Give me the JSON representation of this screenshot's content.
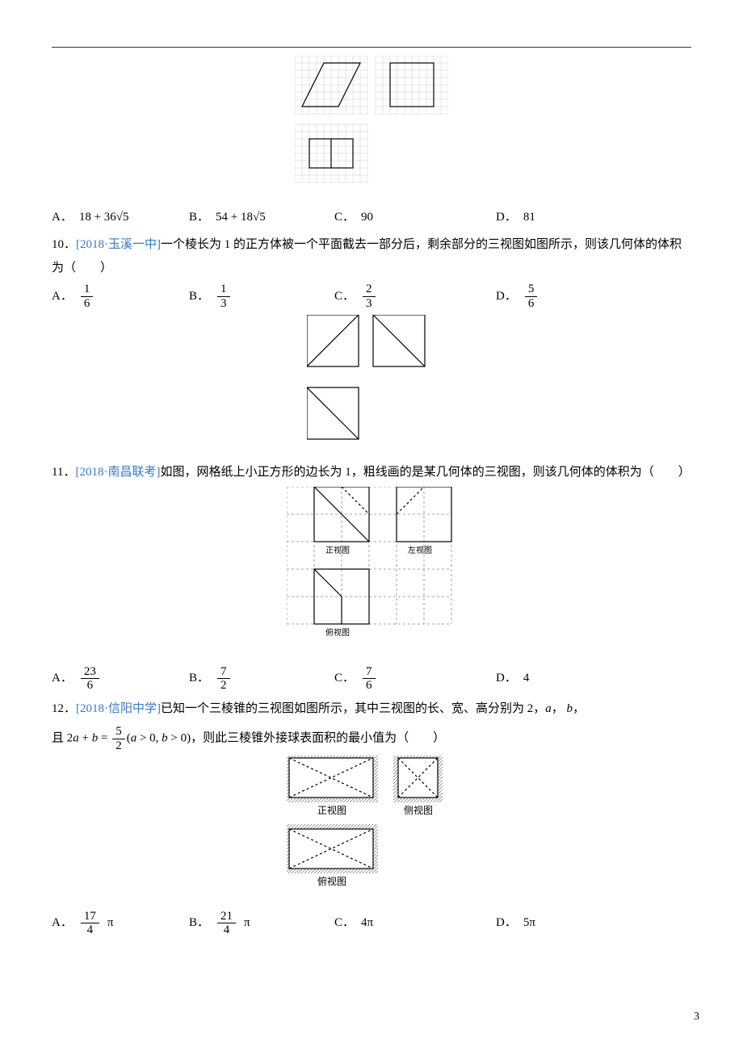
{
  "q9_options": {
    "A": "18 + 36√5",
    "B": "54 + 18√5",
    "C": "90",
    "D": "81"
  },
  "q10": {
    "source": "[2018·玉溪一中]",
    "stem": "一个棱长为 1 的正方体被一个平面截去一部分后，剩余部分的三视图如图所示，则该几何体的体积为（　　）",
    "options": {
      "A_num": "1",
      "A_den": "6",
      "B_num": "1",
      "B_den": "3",
      "C_num": "2",
      "C_den": "3",
      "D_num": "5",
      "D_den": "6"
    }
  },
  "q11": {
    "source": "[2018·南昌联考]",
    "stem": "如图，网格纸上小正方形的边长为 1，粗线画的是某几何体的三视图，则该几何体的体积为（　　）",
    "labels": {
      "front": "正视图",
      "left": "左视图",
      "top": "俯视图"
    },
    "options": {
      "A_num": "23",
      "A_den": "6",
      "B_num": "7",
      "B_den": "2",
      "C_num": "7",
      "C_den": "6",
      "D": "4"
    }
  },
  "q12": {
    "source": "[2018·信阳中学]",
    "stem_a": "已知一个三棱锥的三视图如图所示，其中三视图的长、宽、高分别为 2，",
    "stem_b": "，",
    "stem_c": "，",
    "eq_left": "且 2",
    "eq_mid": " + ",
    "eq_eq": " = ",
    "eq_frac_num": "5",
    "eq_frac_den": "2",
    "eq_paren": "(",
    "eq_cond_a": " > 0, ",
    "eq_cond_b": " > 0",
    "eq_paren_end": ")",
    "stem_end": "，则此三棱锥外接球表面积的最小值为（　　）",
    "labels": {
      "front": "正视图",
      "side": "侧视图",
      "top": "俯视图"
    },
    "options": {
      "A_num": "17",
      "A_den": "4",
      "B_num": "21",
      "B_den": "4",
      "C": "4π",
      "D": "5π"
    },
    "pi": "π",
    "a": "a",
    "b": "b"
  },
  "page_number": "3"
}
